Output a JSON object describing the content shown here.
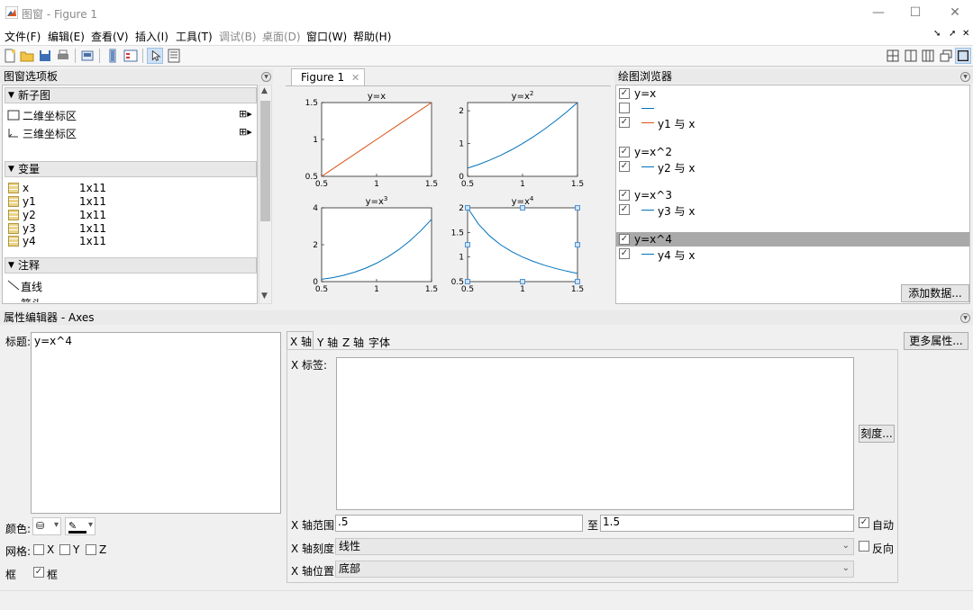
{
  "window": {
    "title": "图窗 - Figure 1"
  },
  "menu": {
    "items": [
      "文件(F)",
      "编辑(E)",
      "查看(V)",
      "插入(I)",
      "工具(T)",
      "调试(B)",
      "桌面(D)",
      "窗口(W)",
      "帮助(H)"
    ]
  },
  "palette": {
    "header": "图窗选项板",
    "sections": {
      "new_subplot": "新子图",
      "variables": "变量",
      "annotations": "注释"
    },
    "new_subplot_items": [
      "二维坐标区",
      "三维坐标区"
    ],
    "variables": [
      {
        "name": "x",
        "size": "1x11"
      },
      {
        "name": "y1",
        "size": "1x11"
      },
      {
        "name": "y2",
        "size": "1x11"
      },
      {
        "name": "y3",
        "size": "1x11"
      },
      {
        "name": "y4",
        "size": "1x11"
      }
    ],
    "annotation_items": [
      "直线",
      "箭头"
    ]
  },
  "figure": {
    "tab_label": "Figure 1"
  },
  "chart_data": [
    {
      "type": "line",
      "title": "y=x",
      "x": [
        0.5,
        0.6,
        0.7,
        0.8,
        0.9,
        1.0,
        1.1,
        1.2,
        1.3,
        1.4,
        1.5
      ],
      "series": [
        {
          "values": [
            0.5,
            0.6,
            0.7,
            0.8,
            0.9,
            1.0,
            1.1,
            1.2,
            1.3,
            1.4,
            1.5
          ],
          "color": "#d95319"
        }
      ],
      "xlim": [
        0.5,
        1.5
      ],
      "ylim": [
        0.5,
        1.5
      ],
      "xticks": [
        "0.5",
        "1",
        "1.5"
      ],
      "yticks": [
        "0.5",
        "1",
        "1.5"
      ]
    },
    {
      "type": "line",
      "title": "y=x",
      "title_sup": "2",
      "x": [
        0.5,
        0.6,
        0.7,
        0.8,
        0.9,
        1.0,
        1.1,
        1.2,
        1.3,
        1.4,
        1.5
      ],
      "series": [
        {
          "values": [
            0.25,
            0.36,
            0.49,
            0.64,
            0.81,
            1.0,
            1.21,
            1.44,
            1.69,
            1.96,
            2.25
          ],
          "color": "#0072bd"
        }
      ],
      "xlim": [
        0.5,
        1.5
      ],
      "ylim": [
        0,
        2.25
      ],
      "xticks": [
        "0.5",
        "1",
        "1.5"
      ],
      "yticks": [
        "0",
        "1",
        "2"
      ]
    },
    {
      "type": "line",
      "title": "y=x",
      "title_sup": "3",
      "x": [
        0.5,
        0.6,
        0.7,
        0.8,
        0.9,
        1.0,
        1.1,
        1.2,
        1.3,
        1.4,
        1.5
      ],
      "series": [
        {
          "values": [
            0.125,
            0.216,
            0.343,
            0.512,
            0.729,
            1.0,
            1.331,
            1.728,
            2.197,
            2.744,
            3.375
          ],
          "color": "#0072bd"
        }
      ],
      "xlim": [
        0.5,
        1.5
      ],
      "ylim": [
        0,
        4
      ],
      "xticks": [
        "0.5",
        "1",
        "1.5"
      ],
      "yticks": [
        "0",
        "2",
        "4"
      ]
    },
    {
      "type": "line",
      "title": "y=x",
      "title_sup": "4",
      "x": [
        0.5,
        0.6,
        0.7,
        0.8,
        0.9,
        1.0,
        1.1,
        1.2,
        1.3,
        1.4,
        1.5
      ],
      "series": [
        {
          "values": [
            2.0,
            1.667,
            1.429,
            1.25,
            1.111,
            1.0,
            0.909,
            0.833,
            0.769,
            0.714,
            0.667
          ],
          "color": "#0072bd"
        }
      ],
      "xlim": [
        0.5,
        1.5
      ],
      "ylim": [
        0.5,
        2
      ],
      "xticks": [
        "0.5",
        "1",
        "1.5"
      ],
      "yticks": [
        "0.5",
        "1",
        "1.5",
        "2"
      ],
      "selected": true
    }
  ],
  "browser": {
    "header": "绘图浏览器",
    "entries": [
      {
        "label": "y=x",
        "checked": true,
        "kind": "axes"
      },
      {
        "label": "",
        "checked": false,
        "kind": "line",
        "color": "#0072bd"
      },
      {
        "label": "y1 与 x",
        "checked": true,
        "kind": "line",
        "color": "#d95319"
      },
      {
        "label": "y=x^2",
        "checked": true,
        "kind": "axes"
      },
      {
        "label": "y2 与 x",
        "checked": true,
        "kind": "line",
        "color": "#0072bd"
      },
      {
        "label": "y=x^3",
        "checked": true,
        "kind": "axes"
      },
      {
        "label": "y3 与 x",
        "checked": true,
        "kind": "line",
        "color": "#0072bd"
      },
      {
        "label": "y=x^4",
        "checked": true,
        "kind": "axes",
        "selected": true
      },
      {
        "label": "y4 与 x",
        "checked": true,
        "kind": "line",
        "color": "#0072bd"
      }
    ],
    "add_data_button": "添加数据..."
  },
  "property_editor": {
    "header": "属性编辑器 - Axes",
    "title_label": "标题:",
    "title_value": "y=x^4",
    "color_label": "颜色:",
    "grid_label": "网格:",
    "grid_x": "X",
    "grid_y": "Y",
    "grid_z": "Z",
    "box_label": "框",
    "box_checkbox": "框",
    "tabs": [
      "X 轴",
      "Y 轴",
      "Z 轴",
      "字体"
    ],
    "xlabel_label": "X 标签:",
    "ticks_button": "刻度...",
    "xlim_label": "X 轴范围:",
    "xlim_min": ".5",
    "to_label": "至",
    "xlim_max": "1.5",
    "auto_label": "自动",
    "xscale_label": "X 轴刻度:",
    "xscale_value": "线性",
    "reverse_label": "反向",
    "xloc_label": "X 轴位置:",
    "xloc_value": "底部",
    "more_props_button": "更多属性..."
  }
}
